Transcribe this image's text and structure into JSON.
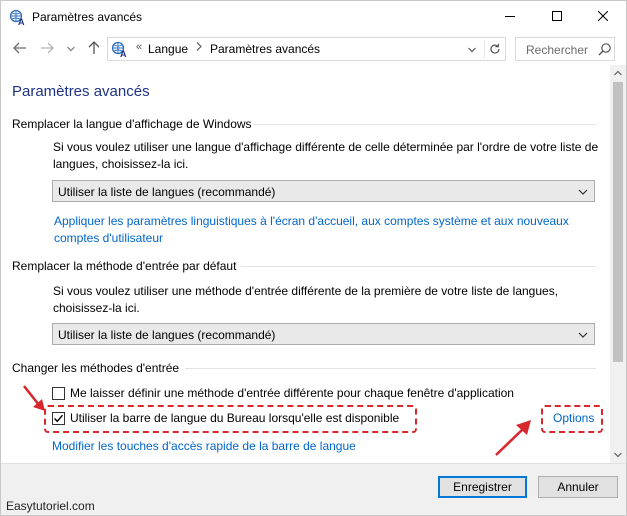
{
  "window": {
    "title": "Paramètres avancés",
    "controls": {
      "minimize": "minimize-icon",
      "maximize": "maximize-icon",
      "close": "close-icon"
    }
  },
  "nav": {
    "back_icon": "arrow-left-icon",
    "forward_icon": "arrow-right-icon",
    "recent_icon": "chevron-down-icon",
    "up_icon": "arrow-up-icon",
    "address": {
      "overflow": "«",
      "crumbs": [
        "Langue",
        "Paramètres avancés"
      ],
      "dropdown_icon": "chevron-down-icon",
      "refresh_icon": "refresh-icon"
    },
    "search": {
      "placeholder": "Rechercher",
      "icon": "search-icon"
    }
  },
  "main": {
    "title": "Paramètres avancés",
    "sections": {
      "display_language": {
        "heading": "Remplacer la langue d'affichage de Windows",
        "description": "Si vous voulez utiliser une langue d'affichage différente de celle déterminée par l'ordre de votre liste de langues, choisissez-la ici.",
        "select_value": "Utiliser la liste de langues (recommandé)",
        "link": "Appliquer les paramètres linguistiques à l'écran d'accueil, aux comptes système et aux nouveaux comptes d'utilisateur"
      },
      "input_method": {
        "heading": "Remplacer la méthode d'entrée par défaut",
        "description": "Si vous voulez utiliser une méthode d'entrée différente de la première de votre liste de langues, choisissez-la ici.",
        "select_value": "Utiliser la liste de langues (recommandé)"
      },
      "switching": {
        "heading": "Changer les méthodes d'entrée",
        "checkbox_per_app": {
          "label": "Me laisser définir une méthode d'entrée différente pour chaque fenêtre d'application",
          "checked": false
        },
        "checkbox_language_bar": {
          "label": "Utiliser la barre de langue du Bureau lorsqu'elle est disponible",
          "checked": true
        },
        "options_link": "Options",
        "hotkeys_link": "Modifier les touches d'accès rapide de la barre de langue"
      }
    }
  },
  "footer": {
    "watermark": "Easytutoriel.com",
    "save_button": "Enregistrer",
    "cancel_button": "Annuler"
  },
  "colors": {
    "title_blue": "#1e3287",
    "link_blue": "#0066cc",
    "highlight_red": "#d9272e",
    "accent": "#0078d7"
  }
}
